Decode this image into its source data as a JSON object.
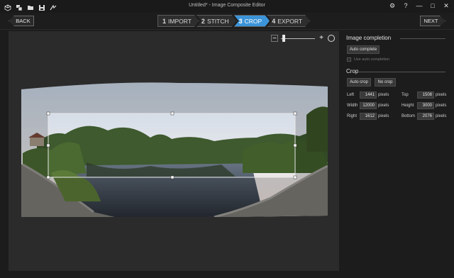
{
  "window": {
    "title": "Untitled* - Image Composite Editor",
    "controls": {
      "settings": "⚙",
      "help": "?",
      "minimize": "—",
      "maximize": "□",
      "close": "✕"
    }
  },
  "toolbar_icons": [
    "new-icon",
    "open-images-icon",
    "open-folder-icon",
    "save-icon",
    "publish-icon"
  ],
  "nav": {
    "back": "BACK",
    "next": "NEXT",
    "steps": [
      {
        "num": "1",
        "label": "IMPORT",
        "active": false
      },
      {
        "num": "2",
        "label": "STITCH",
        "active": false
      },
      {
        "num": "3",
        "label": "CROP",
        "active": true
      },
      {
        "num": "4",
        "label": "EXPORT",
        "active": false
      }
    ]
  },
  "zoom": {
    "minus": "−",
    "plus": "+",
    "level": 0.05
  },
  "panel": {
    "image_completion": {
      "title": "Image completion",
      "auto_complete": "Auto complete",
      "use_auto_completion": "Use auto completion",
      "use_auto_completion_checked": false
    },
    "crop": {
      "title": "Crop",
      "auto_crop": "Auto crop",
      "no_crop": "No crop",
      "fields": {
        "left": {
          "label": "Left",
          "value": "1441",
          "unit": "pixels"
        },
        "top": {
          "label": "Top",
          "value": "1508",
          "unit": "pixels"
        },
        "width": {
          "label": "Width",
          "value": "12000",
          "unit": "pixels"
        },
        "height": {
          "label": "Height",
          "value": "3000",
          "unit": "pixels"
        },
        "right": {
          "label": "Right",
          "value": "1612",
          "unit": "pixels"
        },
        "bottom": {
          "label": "Bottom",
          "value": "2076",
          "unit": "pixels"
        }
      }
    }
  },
  "colors": {
    "accent": "#3c94d8",
    "background": "#1c1c1c",
    "canvas": "#2b2b2b"
  }
}
